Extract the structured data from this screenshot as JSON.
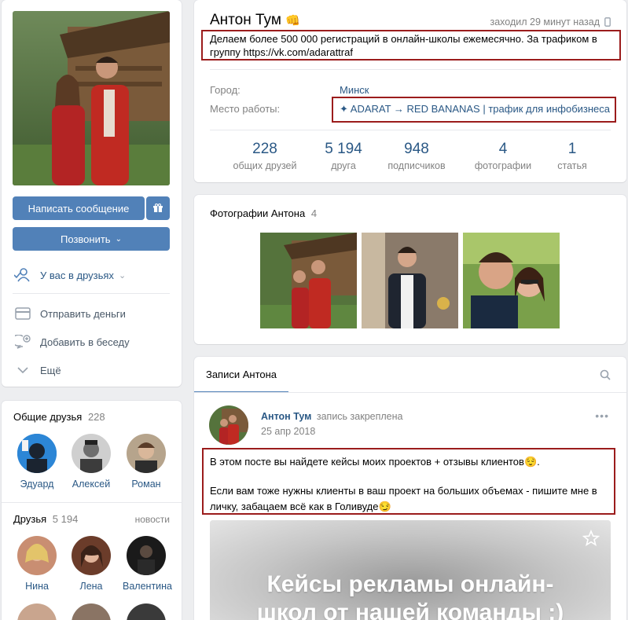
{
  "profile": {
    "name": "Антон Тум",
    "name_emoji": "👊",
    "last_seen": "заходил 29 минут назад",
    "status": "Делаем более 500 000 регистраций в онлайн-школы ежемесячно. За трафиком в группу https://vk.com/adarattraf",
    "info": [
      {
        "label": "Город:",
        "value": "Минск"
      },
      {
        "label": "Место работы:",
        "value": "✦ ADARAT → RED BANANAS | трафик для инфобизнеса"
      }
    ],
    "counters": [
      {
        "value": "228",
        "label": "общих друзей"
      },
      {
        "value": "5 194",
        "label": "друга"
      },
      {
        "value": "948",
        "label": "подписчиков"
      },
      {
        "value": "4",
        "label": "фотографии"
      },
      {
        "value": "1",
        "label": "статья"
      }
    ]
  },
  "actions": {
    "message_label": "Написать сообщение",
    "call_label": "Позвонить",
    "friends_status": "У вас в друзьях",
    "send_money": "Отправить деньги",
    "add_to_chat": "Добавить в беседу",
    "more": "Ещё"
  },
  "common_friends": {
    "title": "Общие друзья",
    "count": "228",
    "items": [
      "Эдуард",
      "Алексей",
      "Роман"
    ]
  },
  "friends": {
    "title": "Друзья",
    "count": "5 194",
    "updates_link": "новости",
    "items": [
      "Нина",
      "Лена",
      "Валентина"
    ]
  },
  "photos": {
    "title": "Фотографии Антона",
    "count": "4"
  },
  "wall": {
    "tab_label": "Записи Антона",
    "post": {
      "author": "Антон Тум",
      "pinned_note": "запись закреплена",
      "date": "25 апр 2018",
      "text_line1": "В этом посте вы найдете кейсы моих проектов + отзывы клиентов😌.",
      "text_line2": "Если вам тоже нужны клиенты в ваш проект на больших объемах - пишите мне в личку, забацаем всё как в Голивуде😏",
      "image_caption": "Кейсы рекламы онлайн-школ от нашей команды :)"
    }
  },
  "colors": {
    "accent": "#5181b8",
    "link": "#2a5885",
    "highlight_border": "#9b1c1c"
  }
}
